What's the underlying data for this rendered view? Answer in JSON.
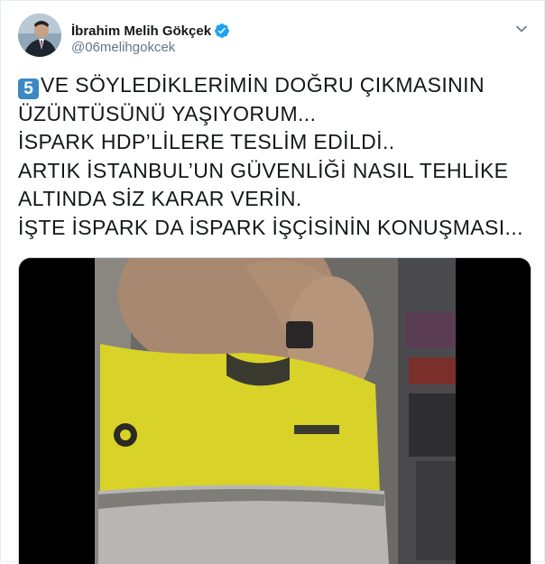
{
  "tweet": {
    "author": {
      "display_name": "İbrahim Melih Gökçek",
      "handle": "@06melihgokcek",
      "verified": true,
      "avatar_icon": "profile-photo"
    },
    "menu_icon": "chevron-down-icon",
    "emoji_keycap": "5",
    "text_lines": [
      "VE SÖYLEDİKLERİMİN DOĞRU ÇIKMASININ",
      "ÜZÜNTÜSÜNÜ YAŞIYORUM...",
      "İSPARK HDP’LİLERE TESLİM EDİLDİ..",
      "ARTIK İSTANBUL’UN GÜVENLİĞİ NASIL TEHLİKE",
      "ALTINDA SİZ KARAR VERİN.",
      "İŞTE İSPARK DA İSPARK İŞÇİSİNİN KONUŞMASI..."
    ],
    "media": {
      "type": "video",
      "description_icon": "video-thumbnail"
    }
  },
  "colors": {
    "text": "#14171a",
    "secondary": "#657786",
    "verified_blue": "#1da1f2",
    "keycap_blue": "#3b88c3",
    "border": "#e6ecf0"
  }
}
